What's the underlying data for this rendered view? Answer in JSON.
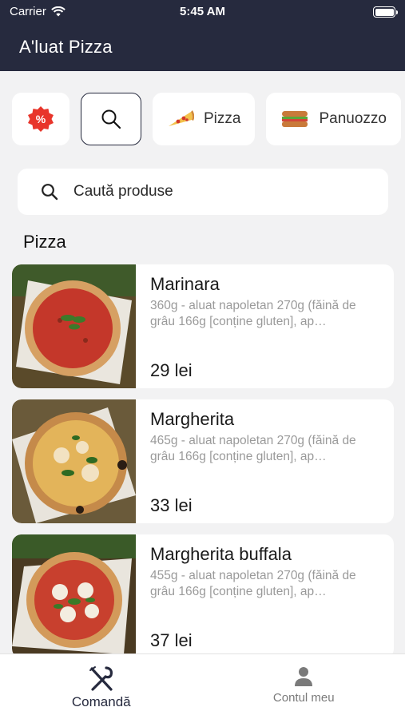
{
  "status_bar": {
    "carrier": "Carrier",
    "time": "5:45 AM"
  },
  "header": {
    "title": "A'luat Pizza"
  },
  "categories": [
    {
      "icon": "discount-badge-icon",
      "label": ""
    },
    {
      "icon": "search-icon",
      "label": "",
      "selected": true
    },
    {
      "icon": "pizza-slice-icon",
      "label": "Pizza"
    },
    {
      "icon": "sandwich-icon",
      "label": "Panuozzo"
    }
  ],
  "search": {
    "placeholder": "Caută produse"
  },
  "section": {
    "title": "Pizza"
  },
  "products": [
    {
      "name": "Marinara",
      "description": "360g - aluat napoletan 270g (făină de grâu 166g [conține gluten], ap…",
      "price": "29 lei"
    },
    {
      "name": "Margherita",
      "description": "465g - aluat napoletan 270g (făină de grâu 166g [conține gluten], ap…",
      "price": "33 lei"
    },
    {
      "name": "Margherita buffala",
      "description": "455g - aluat napoletan 270g (făină de grâu 166g [conține gluten], ap…",
      "price": "37 lei"
    }
  ],
  "tabbar": {
    "order_label": "Comandă",
    "account_label": "Contul meu"
  },
  "colors": {
    "header_bg": "#262a3e",
    "discount_red": "#e8352b"
  }
}
